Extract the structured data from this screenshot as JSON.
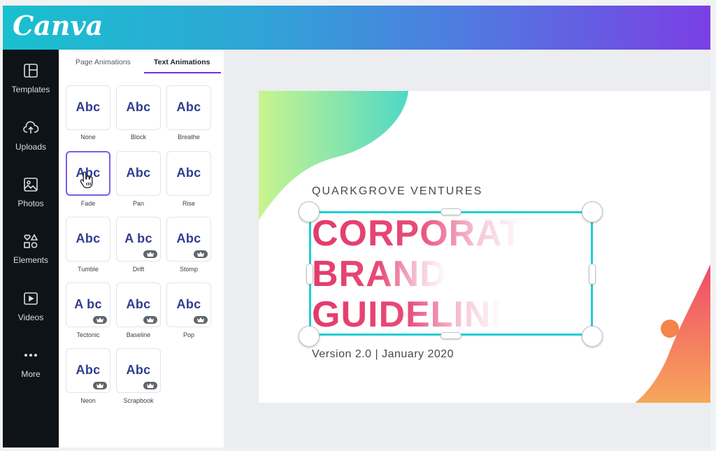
{
  "app": {
    "logo_text": "Canva"
  },
  "sidebar": {
    "items": [
      {
        "label": "Templates",
        "icon": "templates-icon"
      },
      {
        "label": "Uploads",
        "icon": "upload-cloud-icon"
      },
      {
        "label": "Photos",
        "icon": "photos-icon"
      },
      {
        "label": "Elements",
        "icon": "elements-icon"
      },
      {
        "label": "Videos",
        "icon": "video-play-icon"
      },
      {
        "label": "More",
        "icon": "more-dots-icon"
      }
    ]
  },
  "panel": {
    "tabs": [
      {
        "label": "Page Animations",
        "active": false
      },
      {
        "label": "Text Animations",
        "active": true
      }
    ],
    "tile_text": "Abc",
    "animations": [
      {
        "name": "None",
        "preview": "Abc",
        "pro": false,
        "selected": false
      },
      {
        "name": "Block",
        "preview": "Abc",
        "pro": false,
        "selected": false
      },
      {
        "name": "Breathe",
        "preview": "Abc",
        "pro": false,
        "selected": false
      },
      {
        "name": "Fade",
        "preview": "Abc",
        "pro": false,
        "selected": true
      },
      {
        "name": "Pan",
        "preview": "Abc",
        "pro": false,
        "selected": false
      },
      {
        "name": "Rise",
        "preview": "Abc",
        "pro": false,
        "selected": false
      },
      {
        "name": "Tumble",
        "preview": "Abc",
        "pro": false,
        "selected": false
      },
      {
        "name": "Drift",
        "preview": "A bc",
        "pro": true,
        "selected": false
      },
      {
        "name": "Stomp",
        "preview": "Abc",
        "pro": true,
        "selected": false
      },
      {
        "name": "Tectonic",
        "preview": "A bc",
        "pro": true,
        "selected": false
      },
      {
        "name": "Baseline",
        "preview": "Abc",
        "pro": true,
        "selected": false
      },
      {
        "name": "Pop",
        "preview": "Abc",
        "pro": true,
        "selected": false
      },
      {
        "name": "Neon",
        "preview": "Abc",
        "pro": true,
        "selected": false
      },
      {
        "name": "Scrapbook",
        "preview": "Abc",
        "pro": true,
        "selected": false
      }
    ]
  },
  "canvas": {
    "company": "QUARKGROVE VENTURES",
    "headline_lines": [
      "CORPORAT",
      "BRAND",
      "GUIDELINI"
    ],
    "version": "Version 2.0 | January 2020"
  },
  "colors": {
    "header_gradient_start": "#19c0cf",
    "header_gradient_end": "#7b3fe4",
    "accent_purple": "#7d2ae8",
    "selection_cyan": "#1ecdd5",
    "headline_pink": "#e33b6a"
  }
}
